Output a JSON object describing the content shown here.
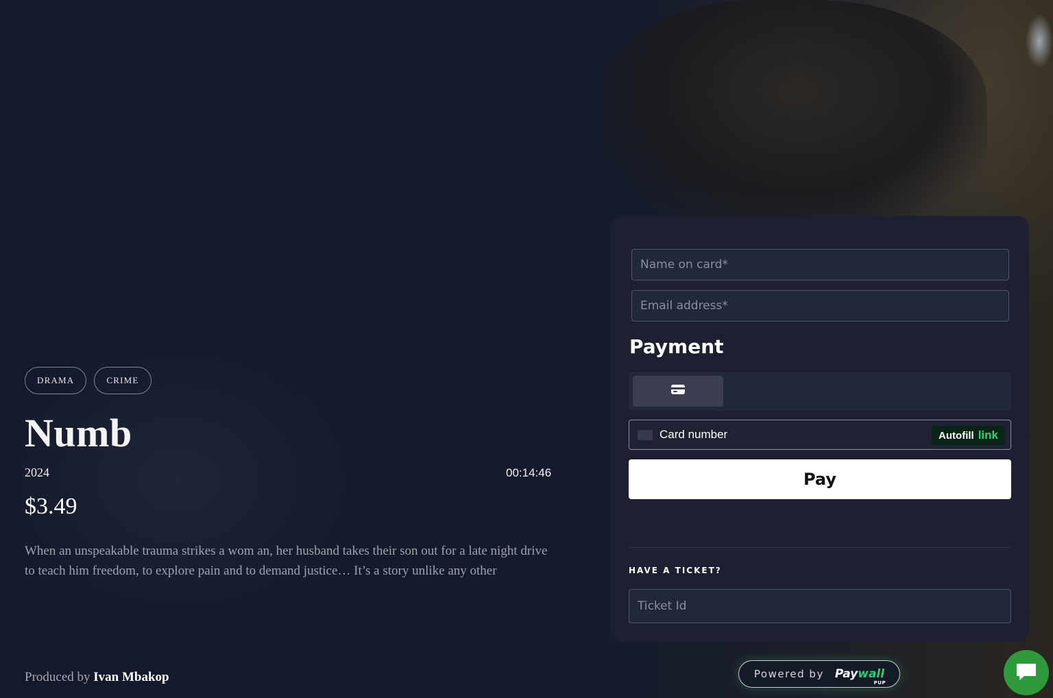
{
  "movie": {
    "genres": [
      "DRAMA",
      "CRIME"
    ],
    "title": "Numb",
    "year": "2024",
    "timer": "00:14:46",
    "price": "$3.49",
    "description": "When an unspeakable trauma strikes a wom an, her husband takes their son out for a late night drive to teach him freedom, to explore pain and to demand justice… It’s a story unlike any other",
    "producer_prefix": "Produced by",
    "producer_name": "Ivan Mbakop"
  },
  "payment_form": {
    "name_placeholder": "Name on card*",
    "email_placeholder": "Email address*",
    "heading": "Payment",
    "method_tab_icon": "credit-card-icon",
    "card_number_label": "Card number",
    "autofill_label": "Autofill",
    "autofill_link": "link",
    "pay_label": "Pay",
    "ticket_heading": "HAVE A TICKET?",
    "ticket_placeholder": "Ticket Id"
  },
  "footer": {
    "powered_by": "Powered by",
    "brand_pay": "Pay",
    "brand_wall": "wall",
    "brand_sub": "PUP"
  },
  "colors": {
    "background": "#141a2b",
    "panel": "#1c2031",
    "accent_green": "#2ecc71",
    "chat_button": "#2f9a3b"
  }
}
